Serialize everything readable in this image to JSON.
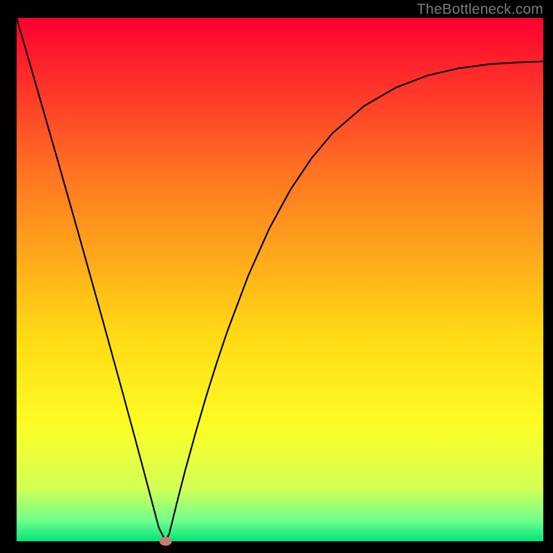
{
  "watermark": {
    "text": "TheBottleneck.com"
  },
  "chart_data": {
    "type": "line",
    "title": "",
    "xlabel": "",
    "ylabel": "",
    "xlim": [
      0,
      100
    ],
    "ylim": [
      0,
      100
    ],
    "grid": false,
    "background_gradient": {
      "stops": [
        {
          "offset": 0.0,
          "color": "#ff0030"
        },
        {
          "offset": 0.3,
          "color": "#ff7522"
        },
        {
          "offset": 0.6,
          "color": "#ffd814"
        },
        {
          "offset": 0.78,
          "color": "#fdfd24"
        },
        {
          "offset": 0.9,
          "color": "#d2ff57"
        },
        {
          "offset": 0.96,
          "color": "#72ff8c"
        },
        {
          "offset": 1.0,
          "color": "#00e57c"
        }
      ]
    },
    "marker": {
      "x": 28.3,
      "y": 0.0,
      "color": "#c77b75"
    },
    "x": [
      0.0,
      2.0,
      4.0,
      6.0,
      8.0,
      10.0,
      12.0,
      14.0,
      16.0,
      18.0,
      20.0,
      22.0,
      24.0,
      26.0,
      27.0,
      28.0,
      28.3,
      29.0,
      30.0,
      31.0,
      32.0,
      34.0,
      36.0,
      38.0,
      40.0,
      44.0,
      48.0,
      52.0,
      56.0,
      60.0,
      66.0,
      72.0,
      78.0,
      84.0,
      90.0,
      95.0,
      100.0
    ],
    "values": [
      100.0,
      93.1,
      86.1,
      79.1,
      72.1,
      65.0,
      57.9,
      50.7,
      43.5,
      36.2,
      28.9,
      21.5,
      14.0,
      6.4,
      2.6,
      0.6,
      0.0,
      1.5,
      5.6,
      9.6,
      13.5,
      20.8,
      27.7,
      34.1,
      40.1,
      50.8,
      59.8,
      67.2,
      73.2,
      78.0,
      83.2,
      86.7,
      89.0,
      90.4,
      91.2,
      91.5,
      91.7
    ]
  }
}
